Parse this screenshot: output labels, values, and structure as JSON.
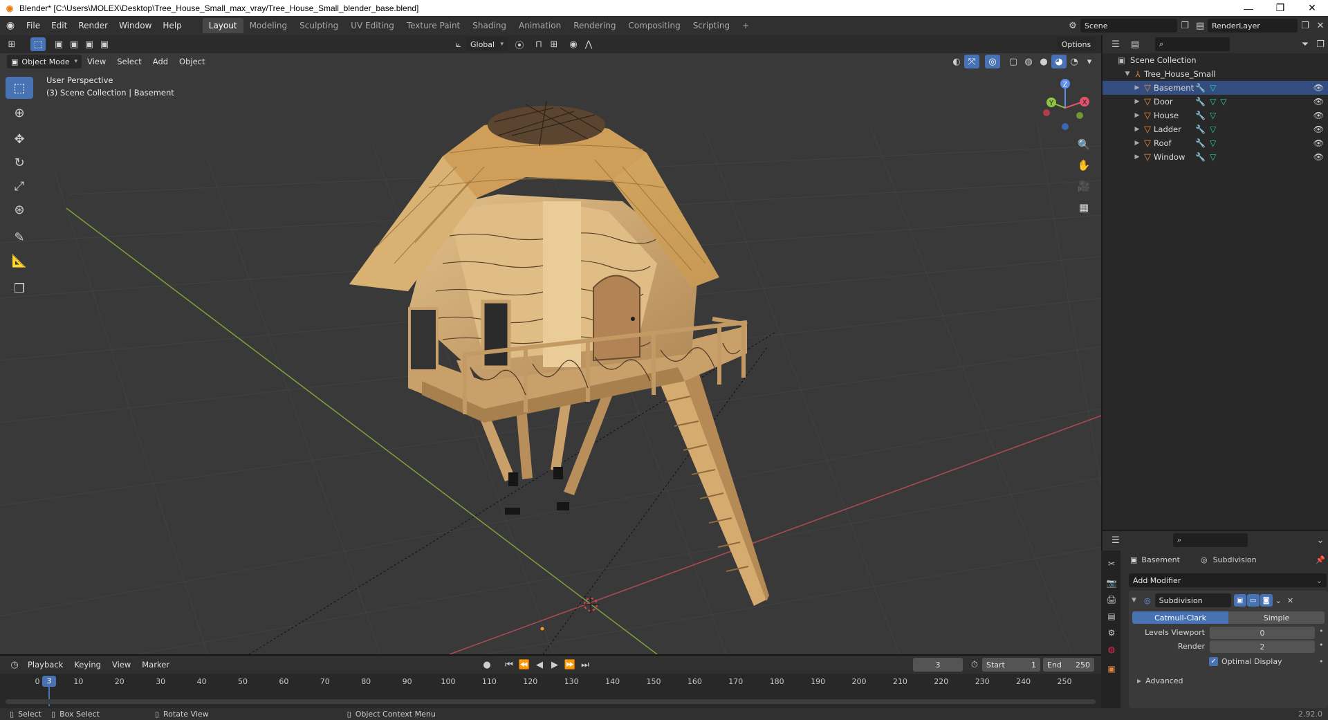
{
  "window": {
    "title": "Blender* [C:\\Users\\MOLEX\\Desktop\\Tree_House_Small_max_vray/Tree_House_Small_blender_base.blend]",
    "controls": [
      "—",
      "❐",
      "✕"
    ]
  },
  "menubar": {
    "items": [
      "File",
      "Edit",
      "Render",
      "Window",
      "Help"
    ],
    "workspaces": [
      "Layout",
      "Modeling",
      "Sculpting",
      "UV Editing",
      "Texture Paint",
      "Shading",
      "Animation",
      "Rendering",
      "Compositing",
      "Scripting"
    ],
    "active_workspace": "Layout",
    "add_tab": "+",
    "scene": "Scene",
    "view_layer": "RenderLayer"
  },
  "viewport_header": {
    "transform_orientation": "Global",
    "options_label": "Options",
    "mode": "Object Mode",
    "menus": [
      "View",
      "Select",
      "Add",
      "Object"
    ]
  },
  "viewport": {
    "perspective_label": "User Perspective",
    "context_label": "(3) Scene Collection | Basement",
    "gizmo": {
      "x": "X",
      "y": "Y",
      "z": "Z"
    },
    "grid_color": "#424242",
    "x_axis_color": "#b04a55",
    "y_axis_color": "#7fa13a"
  },
  "outliner": {
    "root": "Scene Collection",
    "collection": "Tree_House_Small",
    "objects": [
      {
        "name": "Basement",
        "selected": true,
        "mesh_icons": 1
      },
      {
        "name": "Door",
        "selected": false,
        "mesh_icons": 2
      },
      {
        "name": "House",
        "selected": false,
        "mesh_icons": 1
      },
      {
        "name": "Ladder",
        "selected": false,
        "mesh_icons": 1
      },
      {
        "name": "Roof",
        "selected": false,
        "mesh_icons": 1
      },
      {
        "name": "Window",
        "selected": false,
        "mesh_icons": 1
      }
    ]
  },
  "properties": {
    "object_name": "Basement",
    "modifier_context": "Subdivision",
    "add_modifier": "Add Modifier",
    "modifier": {
      "name": "Subdivision",
      "type_options": [
        "Catmull-Clark",
        "Simple"
      ],
      "active_type": "Catmull-Clark",
      "levels_viewport_label": "Levels Viewport",
      "levels_viewport": "0",
      "render_label": "Render",
      "render": "2",
      "optimal_display_label": "Optimal Display",
      "optimal_display": true,
      "advanced_label": "Advanced"
    }
  },
  "timeline": {
    "menus": [
      "Playback",
      "Keying",
      "View",
      "Marker"
    ],
    "current_frame": "3",
    "start_label": "Start",
    "start": "1",
    "end_label": "End",
    "end": "250",
    "ticks": [
      "0",
      "10",
      "20",
      "30",
      "40",
      "50",
      "60",
      "70",
      "80",
      "90",
      "100",
      "110",
      "120",
      "130",
      "140",
      "150",
      "160",
      "170",
      "180",
      "190",
      "200",
      "210",
      "220",
      "230",
      "240",
      "250"
    ]
  },
  "statusbar": {
    "select": "Select",
    "box_select": "Box Select",
    "rotate_view": "Rotate View",
    "context_menu": "Object Context Menu",
    "version": "2.92.0"
  }
}
